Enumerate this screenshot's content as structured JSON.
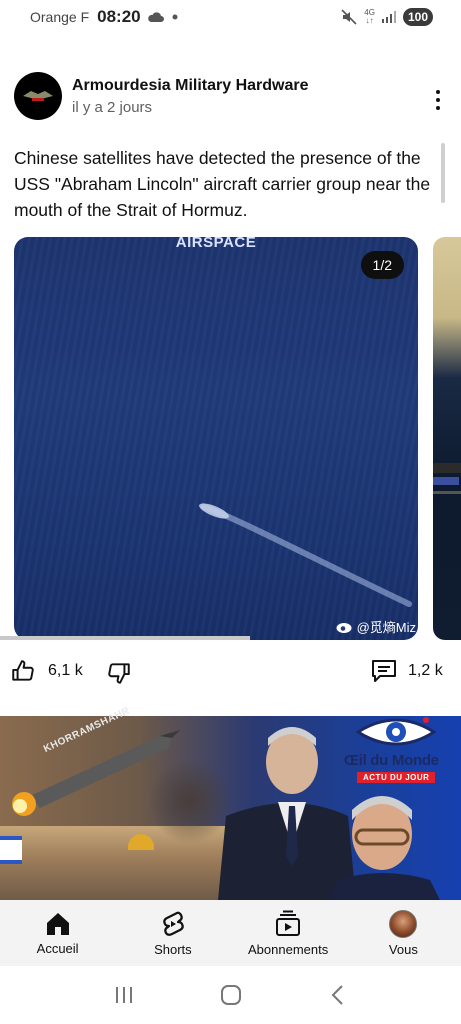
{
  "status_bar": {
    "carrier": "Orange F",
    "time": "08:20",
    "network": "4G",
    "battery": "100"
  },
  "post": {
    "channel_name": "Armourdesia Military Hardware",
    "time_ago": "il y a 2 jours",
    "text": "Chinese satellites have detected the presence of the USS \"Abraham Lincoln\" aircraft carrier group near the mouth of the Strait of Hormuz.",
    "image": {
      "label": "AIRSPACE",
      "counter": "1/2",
      "watermark": "@觅熵Miz"
    },
    "likes": "6,1 k",
    "comments": "1,2 k"
  },
  "next_video": {
    "missile_text": "KHORRAMSHAHR",
    "brand_name": "Œil du Monde",
    "brand_tag": "ACTU DU JOUR"
  },
  "bottom_nav": {
    "items": [
      {
        "label": "Accueil",
        "icon": "home-icon"
      },
      {
        "label": "Shorts",
        "icon": "shorts-icon"
      },
      {
        "label": "Abonnements",
        "icon": "subscriptions-icon"
      },
      {
        "label": "Vous",
        "icon": "avatar"
      }
    ]
  },
  "colors": {
    "accent_red": "#e0202a",
    "text": "#0f0f0f",
    "secondary_text": "#606060",
    "nav_background": "#f3f3f3"
  }
}
